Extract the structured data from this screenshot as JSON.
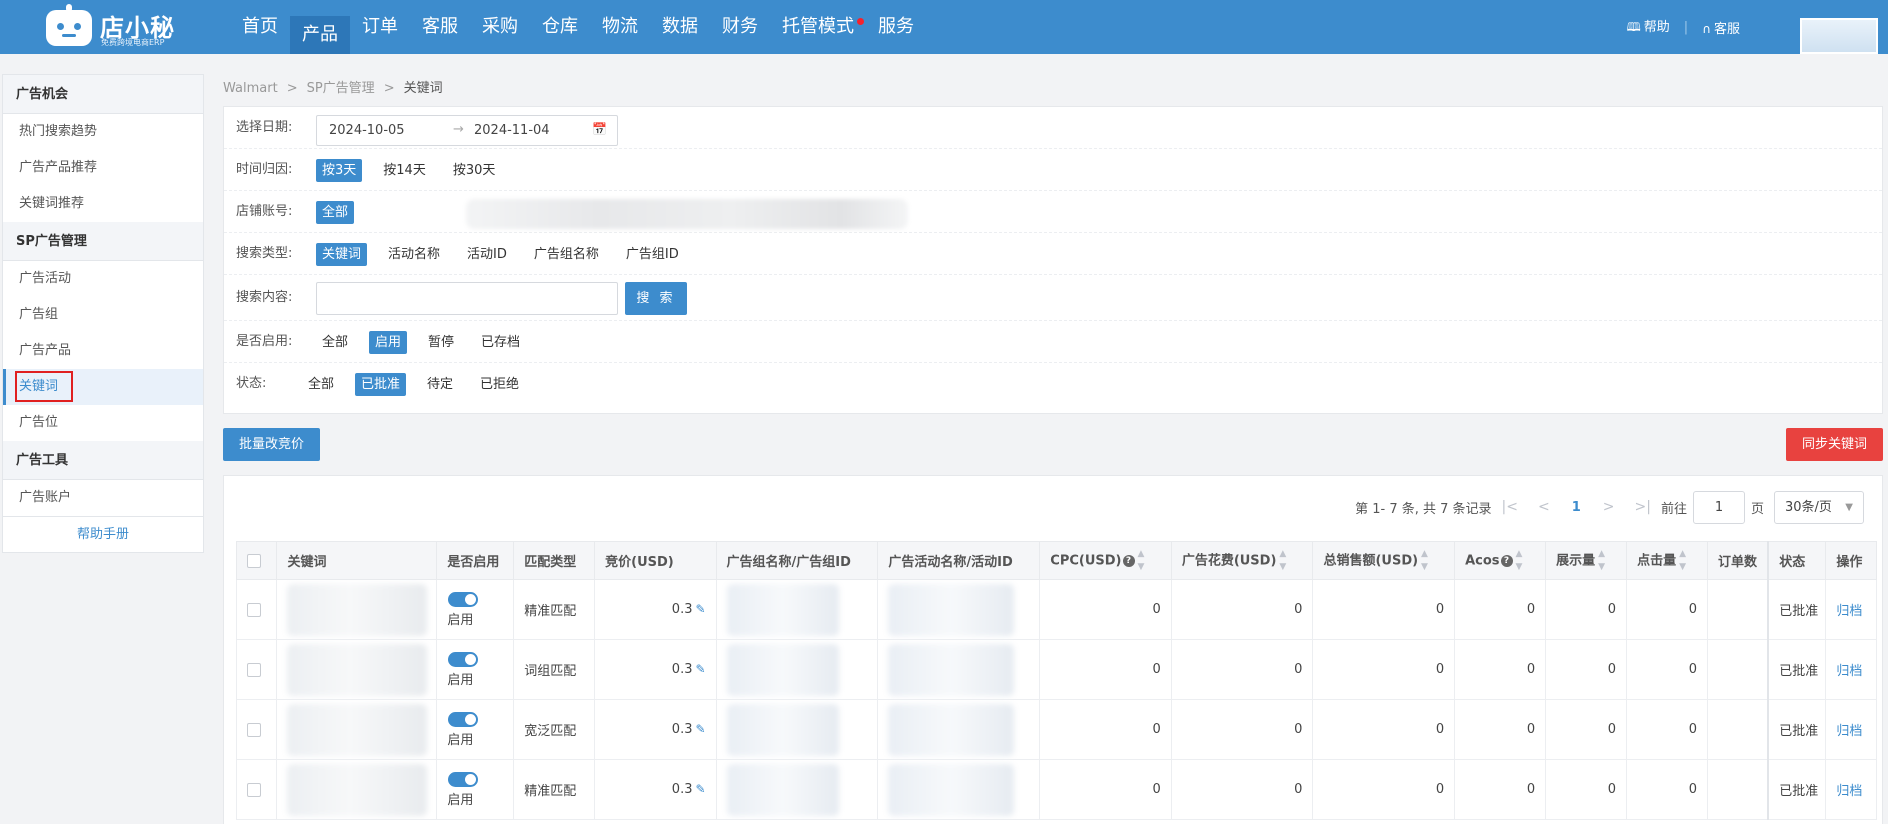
{
  "brand": {
    "name": "店小秘",
    "subtitle": "免费跨境电商ERP"
  },
  "nav": {
    "items": [
      {
        "label": "首页"
      },
      {
        "label": "产品"
      },
      {
        "label": "订单"
      },
      {
        "label": "客服"
      },
      {
        "label": "采购"
      },
      {
        "label": "仓库"
      },
      {
        "label": "物流"
      },
      {
        "label": "数据"
      },
      {
        "label": "财务"
      },
      {
        "label": "托管模式"
      },
      {
        "label": "服务"
      }
    ],
    "active": "产品",
    "help_label": "帮助",
    "service_label": "客服"
  },
  "sidebar": {
    "sections": [
      {
        "title": "广告机会",
        "items": [
          {
            "label": "热门搜索趋势"
          },
          {
            "label": "广告产品推荐"
          },
          {
            "label": "关键词推荐"
          }
        ]
      },
      {
        "title": "SP广告管理",
        "items": [
          {
            "label": "广告活动"
          },
          {
            "label": "广告组"
          },
          {
            "label": "广告产品"
          },
          {
            "label": "关键词"
          },
          {
            "label": "广告位"
          }
        ]
      },
      {
        "title": "广告工具",
        "items": [
          {
            "label": "广告账户"
          }
        ]
      }
    ],
    "active_item": "关键词",
    "help_link": "帮助手册"
  },
  "breadcrumb": {
    "items": [
      "Walmart",
      "SP广告管理",
      "关键词"
    ],
    "separator": ">"
  },
  "filters": {
    "date": {
      "label": "选择日期:",
      "start": "2024-10-05",
      "end": "2024-11-04",
      "arrow": "→"
    },
    "attribution": {
      "label": "时间归因:",
      "options": [
        "按3天",
        "按14天",
        "按30天"
      ],
      "selected": "按3天"
    },
    "store": {
      "label": "店铺账号:",
      "options": [
        "全部"
      ],
      "selected": "全部"
    },
    "search_type": {
      "label": "搜索类型:",
      "options": [
        "关键词",
        "活动名称",
        "活动ID",
        "广告组名称",
        "广告组ID"
      ],
      "selected": "关键词"
    },
    "search_content": {
      "label": "搜索内容:",
      "value": "",
      "button": "搜 索"
    },
    "enabled": {
      "label": "是否启用:",
      "options": [
        "全部",
        "启用",
        "暂停",
        "已存档"
      ],
      "selected": "启用"
    },
    "status": {
      "label": "状态:",
      "options": [
        "全部",
        "已批准",
        "待定",
        "已拒绝"
      ],
      "selected": "已批准"
    }
  },
  "actions": {
    "batch_bid": "批量改竞价",
    "sync_keywords": "同步关键词"
  },
  "pagination": {
    "summary": "第 1- 7 条, 共 7 条记录",
    "current_page": "1",
    "goto_label": "前往",
    "goto_value": "1",
    "page_unit": "页",
    "page_size": "30条/页"
  },
  "table": {
    "columns": {
      "keyword": "关键词",
      "enabled": "是否启用",
      "match_type": "匹配类型",
      "bid": "竞价(USD)",
      "ad_group": "广告组名称/广告组ID",
      "campaign": "广告活动名称/活动ID",
      "cpc": "CPC(USD)",
      "spend": "广告花费(USD)",
      "sales": "总销售额(USD)",
      "acos": "Acos",
      "impressions": "展示量",
      "clicks": "点击量",
      "orders": "订单数",
      "status": "状态",
      "action": "操作"
    },
    "rows": [
      {
        "enabled_label": "启用",
        "match_type": "精准匹配",
        "bid": "0.3",
        "cpc": "0",
        "spend": "0",
        "sales": "0",
        "acos": "0",
        "impressions": "0",
        "clicks": "0",
        "orders": "",
        "status": "已批准",
        "action": "归档"
      },
      {
        "enabled_label": "启用",
        "match_type": "词组匹配",
        "bid": "0.3",
        "cpc": "0",
        "spend": "0",
        "sales": "0",
        "acos": "0",
        "impressions": "0",
        "clicks": "0",
        "orders": "",
        "status": "已批准",
        "action": "归档"
      },
      {
        "enabled_label": "启用",
        "match_type": "宽泛匹配",
        "bid": "0.3",
        "cpc": "0",
        "spend": "0",
        "sales": "0",
        "acos": "0",
        "impressions": "0",
        "clicks": "0",
        "orders": "",
        "status": "已批准",
        "action": "归档"
      },
      {
        "enabled_label": "启用",
        "match_type": "精准匹配",
        "bid": "0.3",
        "cpc": "0",
        "spend": "0",
        "sales": "0",
        "acos": "0",
        "impressions": "0",
        "clicks": "0",
        "orders": "",
        "status": "已批准",
        "action": "归档"
      }
    ]
  },
  "colors": {
    "primary": "#3d8ccd",
    "danger": "#e8423f",
    "highlight_border": "#e02020"
  }
}
